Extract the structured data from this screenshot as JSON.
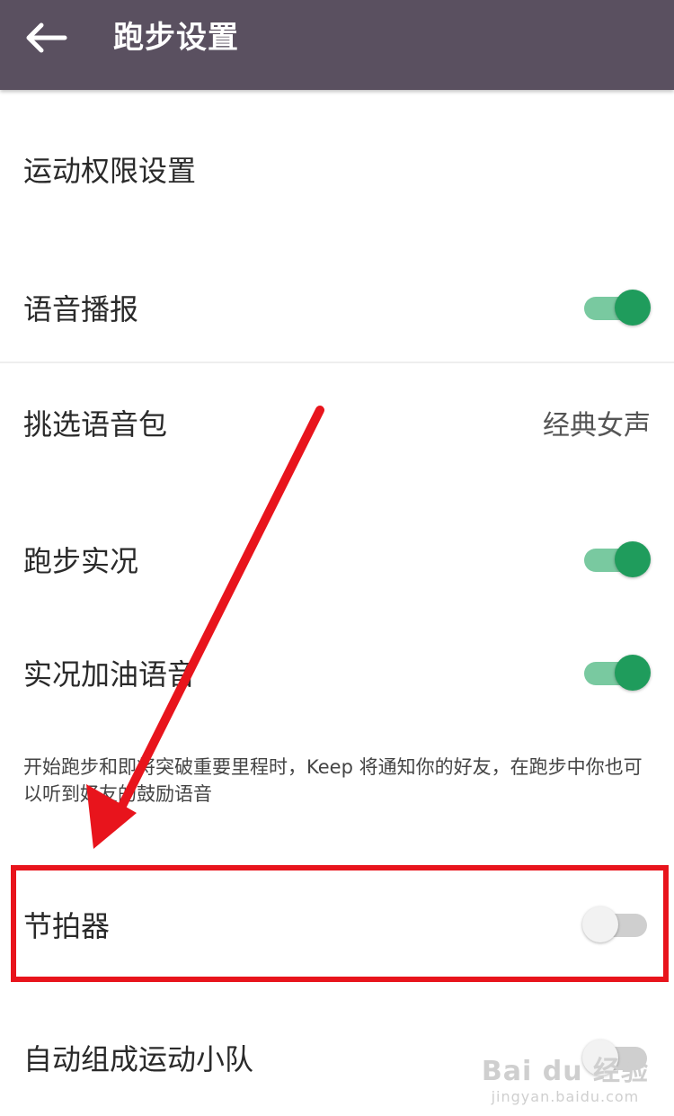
{
  "header": {
    "title": "跑步设置",
    "back_icon": "arrow-left-icon"
  },
  "settings": {
    "permissions": {
      "label": "运动权限设置"
    },
    "voice_broadcast": {
      "label": "语音播报",
      "enabled": true
    },
    "voice_pack": {
      "label": "挑选语音包",
      "value": "经典女声"
    },
    "run_live": {
      "label": "跑步实况",
      "enabled": true
    },
    "cheer_voice": {
      "label": "实况加油语音",
      "enabled": true,
      "note": "开始跑步和即将突破重要里程时，Keep 将通知你的好友，在跑步中你也可以听到好友的鼓励语音"
    },
    "metronome": {
      "label": "节拍器",
      "enabled": false
    },
    "auto_team": {
      "label": "自动组成运动小队",
      "enabled": false
    }
  },
  "colors": {
    "header_bg": "#5a5060",
    "toggle_on": "#1f9c5c",
    "annotation_red": "#e8141c"
  },
  "watermark": {
    "main": "Bai du 经验",
    "sub": "jingyan.baidu.com"
  }
}
